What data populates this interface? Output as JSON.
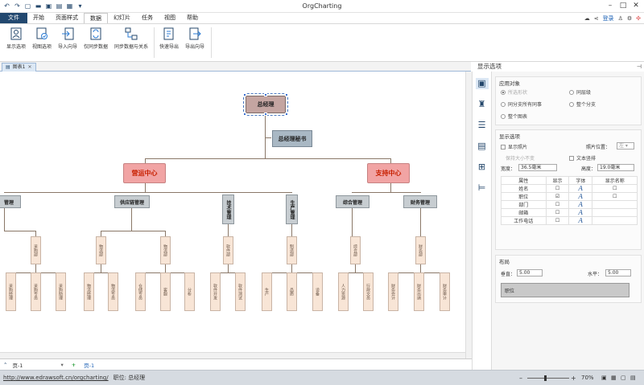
{
  "app": {
    "title": "OrgCharting"
  },
  "menu": {
    "file": "文件",
    "items": [
      "开始",
      "页面样式",
      "数据",
      "幻灯片",
      "任务",
      "视图",
      "帮助"
    ],
    "active": "数据",
    "login": "登录"
  },
  "ribbon": {
    "buttons": [
      "显示选项",
      "视图选项",
      "导入向导",
      "仅同步数据",
      "同步数据与关系",
      "快速导出",
      "导出向导"
    ]
  },
  "doc_tab": {
    "label": "图表1"
  },
  "panel": {
    "title": "显示选项",
    "apply": {
      "header": "应用对象",
      "options": [
        "所选形状",
        "同层级",
        "同分支所有同事",
        "整个分支",
        "整个图表"
      ]
    },
    "display": {
      "header": "显示选项",
      "show_photo": "显示照片",
      "photo_pos_label": "照片位置：",
      "photo_pos_value": "左",
      "keep_size": "保持大小不变",
      "text_wrap": "文本竖排",
      "width_label": "宽度：",
      "width_value": "36.5毫米",
      "height_label": "高度：",
      "height_value": "19.0毫米",
      "table_headers": [
        "属性",
        "显示",
        "字体",
        "显示名称"
      ],
      "rows": [
        "姓名",
        "职位",
        "部门",
        "邮箱",
        "工作电话"
      ],
      "font_glyph": "A"
    },
    "layout": {
      "header": "布局",
      "vert_label": "垂直：",
      "vert_value": "5.00",
      "horiz_label": "水平：",
      "horiz_value": "5.00",
      "preview": "职位"
    }
  },
  "pagebar": {
    "page_label": "页-1",
    "page_tab": "页-1"
  },
  "status": {
    "url": "http://www.edrawsoft.cn/orgcharting/",
    "info": "职位: 总经理",
    "zoom": "70%"
  },
  "org": {
    "boss": "总经理",
    "secretary": "总经理秘书",
    "centers": [
      "营运中心",
      "支持中心"
    ],
    "depts": [
      "管理",
      "供应链管理",
      "技术管理",
      "生产管理",
      "综合管理",
      "财务管理"
    ],
    "mids": [
      "采购部",
      "物流部",
      "软件部",
      "制造部",
      "综合部",
      "财务部"
    ],
    "leaves": [
      "采购经理",
      "采购专员",
      "采购助理",
      "物流经理",
      "物流专员",
      "仓储专员",
      "客服",
      "分析",
      "软件开发",
      "软件测试",
      "生产",
      "品质",
      "设备",
      "人力资源",
      "行政文员",
      "财务会计",
      "财务出纳",
      "财务审计"
    ]
  }
}
